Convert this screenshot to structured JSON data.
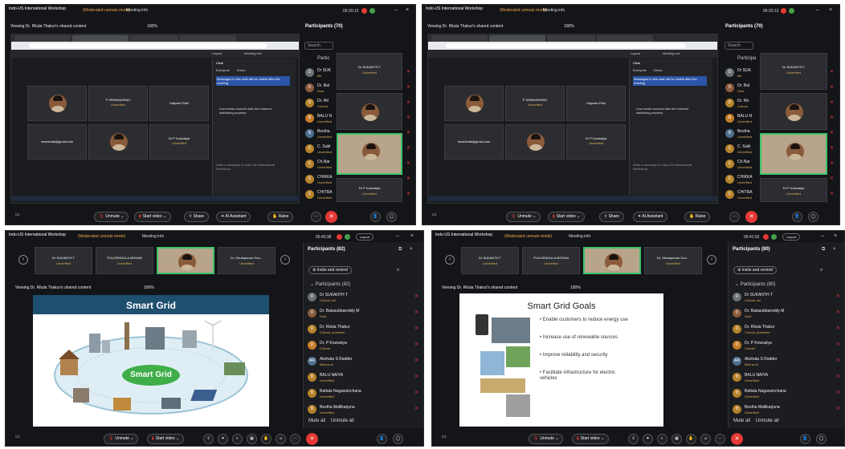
{
  "common": {
    "meeting_title": "Indo-US International Workshop",
    "moderated": "(Moderated unmute mode)",
    "meeting_info": "Meeting info",
    "viewing": "Viewing Dr. Ritula Thakur's shared content",
    "zoom": "100%",
    "unmute": "Unmute",
    "start_video": "Start video",
    "share": "Share",
    "ai_assistant": "AI Assistant",
    "raise": "Raise",
    "layout": "Layout",
    "unverified": "Unverified",
    "search": "Search",
    "invite": "Invite and remind",
    "mute_all": "Mute all",
    "unmute_all": "Unmute all"
  },
  "p1": {
    "clock": "06:20:12",
    "participants_title": "Participants (70)",
    "panel_label": "Partic",
    "chat_title": "Chat",
    "chat_tabs": [
      "Everyone",
      "Direct"
    ],
    "chat_highlight": "Messages in this chat will be visible after the meeting",
    "chat_lines": [
      "Low inertia sources lack the inherent stabilising property"
    ],
    "chat_input": "Write a message to Indo-US International Workshop",
    "tiles": [
      {
        "name": "",
        "sub": ""
      },
      {
        "name": "P SRINIVASRAO",
        "sub": "Unverified"
      },
      {
        "name": "Kalpesh.Patil",
        "sub": "Unverified"
      },
      {
        "name": "nmshindia@gmail.com",
        "sub": ""
      },
      {
        "name": "",
        "sub": ""
      },
      {
        "name": "Dr P Kowsalya",
        "sub": "Unverified"
      }
    ],
    "right_tiles": [
      {
        "name": "Dr SUKANTH T",
        "sub": "Unverified"
      },
      {
        "name": "",
        "sub": ""
      },
      {
        "name": "Dr P Kowsalya",
        "sub": "Unverified"
      }
    ],
    "participants": [
      {
        "initial": "D",
        "name": "Dr SUK",
        "role": "Me"
      },
      {
        "initial": "D",
        "name": "Dr. Bal",
        "role": "Host"
      },
      {
        "initial": "D",
        "name": "Dr. Rit",
        "role": "Cohost"
      },
      {
        "initial": "B",
        "name": "BALU N",
        "role": "Unverified"
      },
      {
        "initial": "B",
        "name": "Bestha",
        "role": "Unverified"
      },
      {
        "initial": "C",
        "name": "C. Subl",
        "role": "Unverified"
      },
      {
        "initial": "C",
        "name": "Ch.Nar",
        "role": "Unverified"
      },
      {
        "initial": "C",
        "name": "CHIKKA",
        "role": "Unverified"
      },
      {
        "initial": "C",
        "name": "CHITRA",
        "role": "Unverified"
      }
    ]
  },
  "p2": {
    "clock": "06:20:12",
    "participants_title": "Participants (70)",
    "panel_label": "Participa",
    "chat_title": "Chat",
    "chat_tabs": [
      "Everyone",
      "Direct"
    ],
    "chat_highlight": "Messages in this chat will be visible after the meeting",
    "chat_lines": [
      "Low inertia sources lack the inherent stabilising property"
    ],
    "chat_input": "Write a message to Indo-US International Workshop",
    "tiles": [
      {
        "name": "",
        "sub": ""
      },
      {
        "name": "P SRINIVASRAO",
        "sub": "Unverified"
      },
      {
        "name": "Kalpesh.Patil",
        "sub": "Unverified"
      },
      {
        "name": "nmshindia@gmail.com",
        "sub": ""
      },
      {
        "name": "",
        "sub": ""
      },
      {
        "name": "Dr P Kowsalya",
        "sub": "Unverified"
      }
    ],
    "right_tiles": [
      {
        "name": "Dr SUKANTH T",
        "sub": "Unverified"
      },
      {
        "name": "",
        "sub": ""
      },
      {
        "name": "Dr P Kowsalya",
        "sub": "Unverified"
      }
    ],
    "participants": [
      {
        "initial": "D",
        "name": "Dr SUK",
        "role": "Me"
      },
      {
        "initial": "D",
        "name": "Dr. Bal",
        "role": "Host"
      },
      {
        "initial": "D",
        "name": "Dr. Rit",
        "role": "Cohost"
      },
      {
        "initial": "B",
        "name": "BALU N",
        "role": "Unverified"
      },
      {
        "initial": "B",
        "name": "Bestha",
        "role": "Unverified"
      },
      {
        "initial": "C",
        "name": "C. Subl",
        "role": "Unverified"
      },
      {
        "initial": "C",
        "name": "Ch.Nar",
        "role": "Unverified"
      },
      {
        "initial": "C",
        "name": "CHIKKA",
        "role": "Unverified"
      },
      {
        "initial": "C",
        "name": "CHITRA",
        "role": "Unverified"
      }
    ]
  },
  "p3": {
    "clock": "06:40:38",
    "participants_title": "Participants (82)",
    "participants_section": "Participants (82)",
    "thumbs": [
      "Dr SUKANTH T",
      "PULIVENDULA MOHAN",
      "",
      "Dr. Obulapuram Gno..."
    ],
    "slide_title": "Smart Grid",
    "center_label": "Smart Grid",
    "participants": [
      {
        "initial": "D",
        "name": "Dr SUKANTH T",
        "role": "Cohost, me"
      },
      {
        "initial": "D",
        "name": "Dr. Balasubbareddy M",
        "role": "Host"
      },
      {
        "initial": "D",
        "name": "Dr. Ritula Thakur",
        "role": "Cohost, presenter"
      },
      {
        "initial": "D",
        "name": "Dr. P Kowsalya",
        "role": "Cohost"
      },
      {
        "initial": "AR",
        "name": "Akshata S Radder",
        "role": "Mell.ac.in"
      },
      {
        "initial": "B",
        "name": "BALU NAIYA",
        "role": "Unverified"
      },
      {
        "initial": "B",
        "name": "Battala Nagasulochana",
        "role": "Unverified"
      },
      {
        "initial": "B",
        "name": "Bestha Mallikarjuna",
        "role": "Unverified"
      }
    ]
  },
  "p4": {
    "clock": "06:41:02",
    "participants_title": "Participants (80)",
    "participants_section": "Participants (80)",
    "thumbs": [
      "Dr SUKANTH T",
      "PULIVENDULA MOHAN",
      "",
      "Dr. Obulapuram Gno..."
    ],
    "slide_title": "Smart Grid Goals",
    "goals": [
      "Enable customers to reduce energy use",
      "Increase use of renewable sources",
      "Improve reliability and security",
      "Facilitate infrastructure for electric vehicles"
    ],
    "participants": [
      {
        "initial": "D",
        "name": "Dr SUKANTH T",
        "role": "Cohost, me"
      },
      {
        "initial": "D",
        "name": "Dr. Balasubbareddy M",
        "role": "Host"
      },
      {
        "initial": "D",
        "name": "Dr. Ritula Thakur",
        "role": "Cohost, presenter"
      },
      {
        "initial": "D",
        "name": "Dr. P Kowsalya",
        "role": "Cohost"
      },
      {
        "initial": "AR",
        "name": "Akshata S Radder",
        "role": "Mell.ac.in"
      },
      {
        "initial": "B",
        "name": "BALU NAIYA",
        "role": "Unverified"
      },
      {
        "initial": "B",
        "name": "Battala Nagasulochana",
        "role": "Unverified"
      },
      {
        "initial": "B",
        "name": "Bestha Mallikarjuna",
        "role": "Unverified"
      }
    ]
  },
  "colors": {
    "leave": "#e53935",
    "accent_blue": "#2b56a8",
    "moderated": "#f0a44c",
    "unverified": "#e2b35b"
  }
}
